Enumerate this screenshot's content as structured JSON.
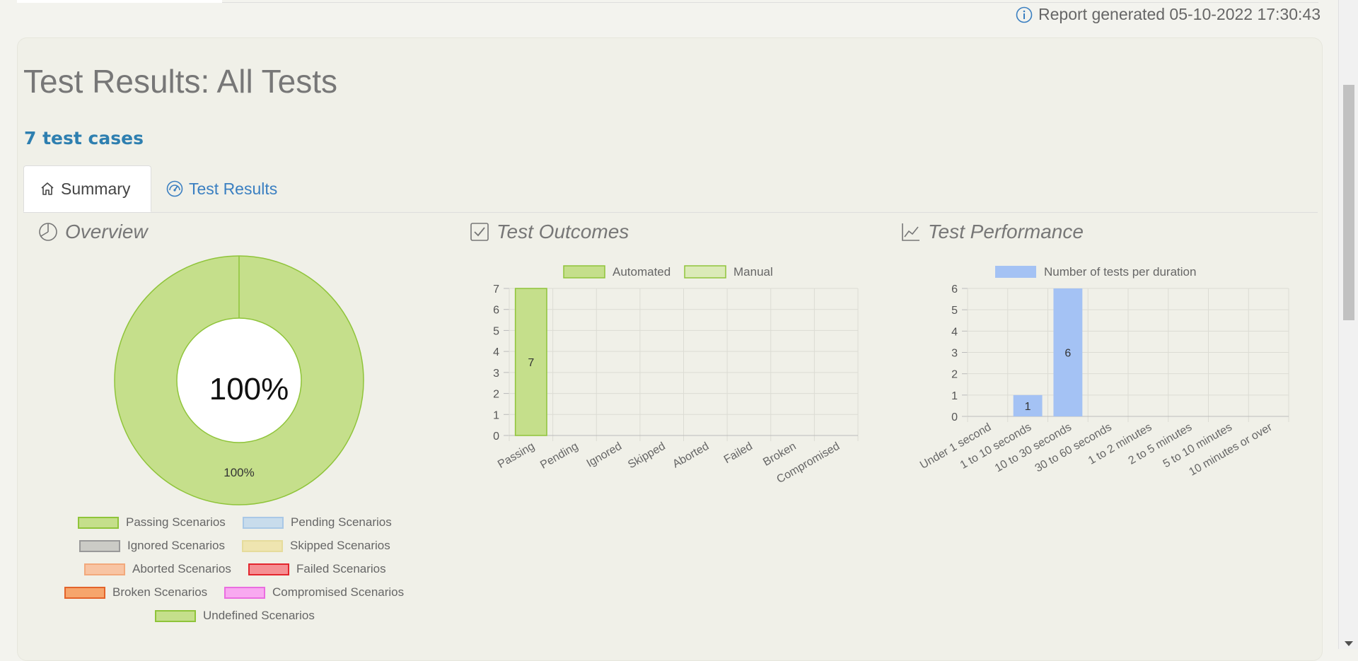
{
  "header": {
    "report_generated": "Report generated 05-10-2022 17:30:43"
  },
  "page": {
    "title": "Test Results: All Tests",
    "case_count": "7 test cases"
  },
  "tabs": [
    {
      "label": "Summary",
      "icon": "home-icon",
      "active": true
    },
    {
      "label": "Test Results",
      "icon": "speedometer-icon",
      "active": false
    }
  ],
  "overview": {
    "title": "Overview",
    "center_label": "100%",
    "slice_label": "100%",
    "legend": [
      {
        "label": "Passing Scenarios",
        "fill": "#c5df8b",
        "stroke": "#8fc43a"
      },
      {
        "label": "Pending Scenarios",
        "fill": "#c8dcec",
        "stroke": "#a9c8e6"
      },
      {
        "label": "Ignored Scenarios",
        "fill": "#cbcbc6",
        "stroke": "#999999"
      },
      {
        "label": "Skipped Scenarios",
        "fill": "#efe5b0",
        "stroke": "#e6dc9c"
      },
      {
        "label": "Aborted Scenarios",
        "fill": "#f8c4a3",
        "stroke": "#f2a97c"
      },
      {
        "label": "Failed Scenarios",
        "fill": "#f58f93",
        "stroke": "#e3262e"
      },
      {
        "label": "Broken Scenarios",
        "fill": "#f6a56c",
        "stroke": "#e3632a"
      },
      {
        "label": "Compromised Scenarios",
        "fill": "#f8a9f0",
        "stroke": "#ea6ee0"
      },
      {
        "label": "Undefined Scenarios",
        "fill": "#c5df8b",
        "stroke": "#8fc43a"
      }
    ]
  },
  "outcomes": {
    "title": "Test Outcomes",
    "legend": [
      "Automated",
      "Manual"
    ]
  },
  "performance": {
    "title": "Test Performance",
    "legend": "Number of tests per duration"
  },
  "chart_data": [
    {
      "type": "pie",
      "title": "Overview",
      "labels": [
        "Passing Scenarios",
        "Pending Scenarios",
        "Ignored Scenarios",
        "Skipped Scenarios",
        "Aborted Scenarios",
        "Failed Scenarios",
        "Broken Scenarios",
        "Compromised Scenarios",
        "Undefined Scenarios"
      ],
      "values": [
        100,
        0,
        0,
        0,
        0,
        0,
        0,
        0,
        0
      ],
      "colors": [
        "#c5df8b",
        "#c8dcec",
        "#cbcbc6",
        "#efe5b0",
        "#f8c4a3",
        "#f58f93",
        "#f6a56c",
        "#f8a9f0",
        "#c5df8b"
      ]
    },
    {
      "type": "bar",
      "title": "Test Outcomes",
      "categories": [
        "Passing",
        "Pending",
        "Ignored",
        "Skipped",
        "Aborted",
        "Failed",
        "Broken",
        "Compromised"
      ],
      "series": [
        {
          "name": "Automated",
          "values": [
            7,
            0,
            0,
            0,
            0,
            0,
            0,
            0
          ],
          "color": "#c5df8b"
        },
        {
          "name": "Manual",
          "values": [
            0,
            0,
            0,
            0,
            0,
            0,
            0,
            0
          ],
          "color": "#dbeab8"
        }
      ],
      "ylim": [
        0,
        7
      ],
      "yticks": [
        0,
        1,
        2,
        3,
        4,
        5,
        6,
        7
      ],
      "grid": true,
      "legend_position": "top"
    },
    {
      "type": "bar",
      "title": "Test Performance",
      "categories": [
        "Under 1 second",
        "1 to 10 seconds",
        "10 to 30 seconds",
        "30 to 60 seconds",
        "1 to 2 minutes",
        "2 to 5 minutes",
        "5 to 10 minutes",
        "10 minutes or over"
      ],
      "series": [
        {
          "name": "Number of tests per duration",
          "values": [
            0,
            1,
            6,
            0,
            0,
            0,
            0,
            0
          ],
          "color": "#a4c2f4"
        }
      ],
      "ylim": [
        0,
        6
      ],
      "yticks": [
        0,
        1,
        2,
        3,
        4,
        5,
        6
      ],
      "grid": true,
      "legend_position": "top"
    }
  ]
}
